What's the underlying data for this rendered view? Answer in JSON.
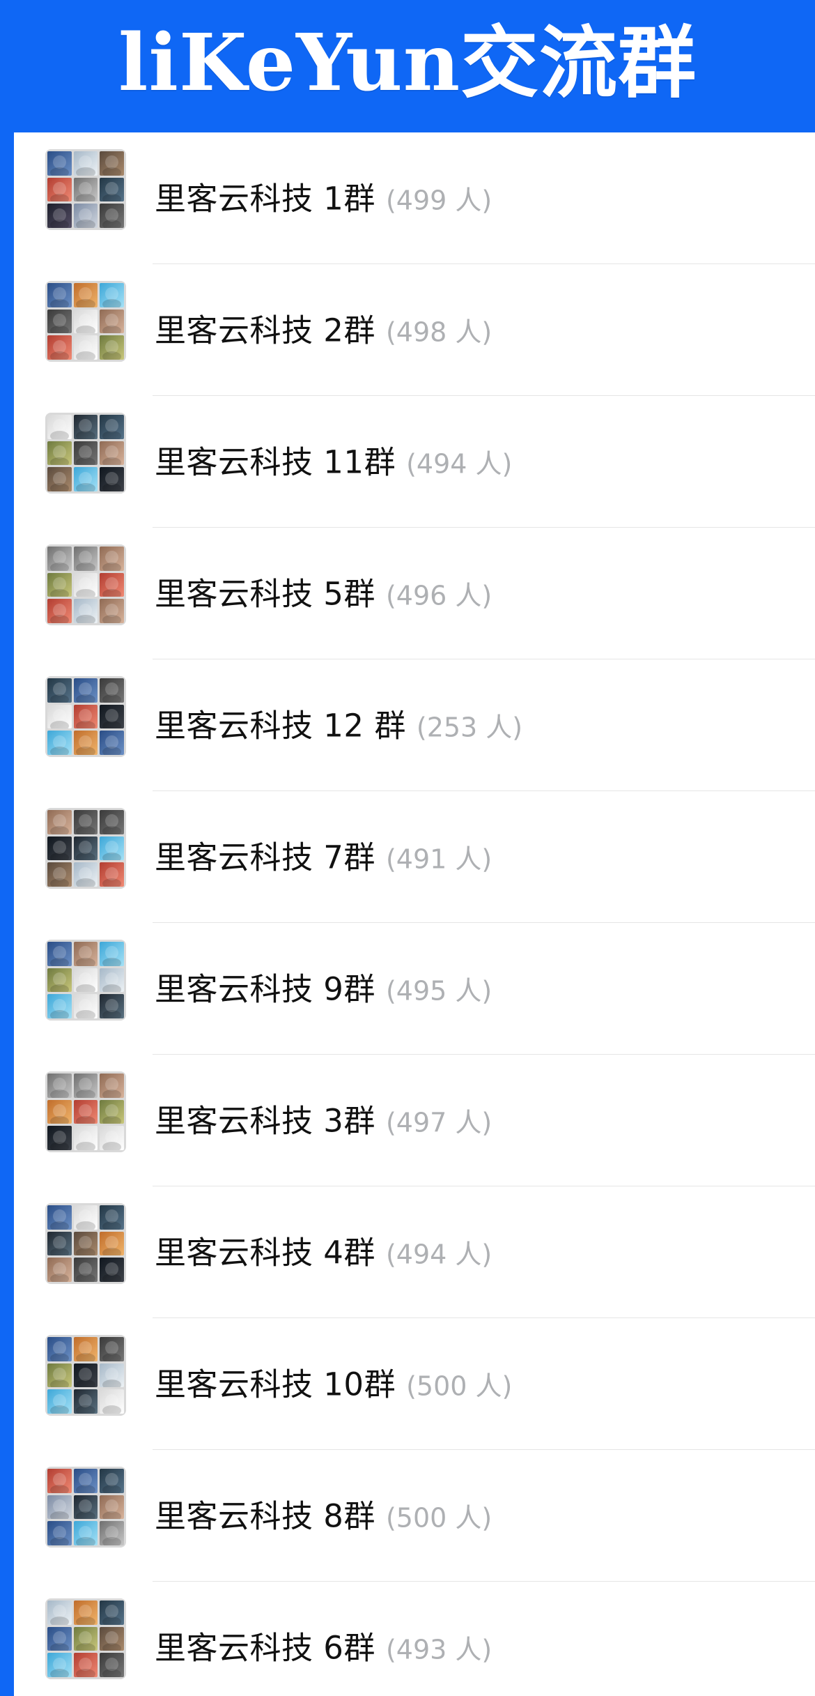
{
  "banner": {
    "title": "liKeYun交流群"
  },
  "groups": [
    {
      "name": "里客云科技 1群",
      "count": "(499 人)",
      "avatar_tiles": [
        "c0",
        "c7",
        "c2",
        "c4",
        "c3",
        "c5",
        "c8",
        "c1",
        "c6"
      ]
    },
    {
      "name": "里客云科技 2群",
      "count": "(498 人)",
      "avatar_tiles": [
        "c0",
        "c15",
        "c9",
        "c6",
        "c13",
        "c11",
        "c4",
        "c13",
        "c10"
      ]
    },
    {
      "name": "里客云科技 11群",
      "count": "(494 人)",
      "avatar_tiles": [
        "c13",
        "c12",
        "c5",
        "c10",
        "c6",
        "c11",
        "c2",
        "c9",
        "c14"
      ]
    },
    {
      "name": "里客云科技 5群",
      "count": "(496 人)",
      "avatar_tiles": [
        "c3",
        "c3",
        "c11",
        "c10",
        "c13",
        "c4",
        "c4",
        "c7",
        "c11"
      ]
    },
    {
      "name": "里客云科技 12 群",
      "count": "(253 人)",
      "avatar_tiles": [
        "c5",
        "c0",
        "c6",
        "c13",
        "c4",
        "c14",
        "c9",
        "c15",
        "c0"
      ]
    },
    {
      "name": "里客云科技 7群",
      "count": "(491 人)",
      "avatar_tiles": [
        "c11",
        "c6",
        "c6",
        "c14",
        "c12",
        "c9",
        "c2",
        "c7",
        "c4"
      ]
    },
    {
      "name": "里客云科技 9群",
      "count": "(495 人)",
      "avatar_tiles": [
        "c0",
        "c11",
        "c9",
        "c10",
        "c13",
        "c7",
        "c9",
        "c13",
        "c12"
      ]
    },
    {
      "name": "里客云科技 3群",
      "count": "(497 人)",
      "avatar_tiles": [
        "c3",
        "c3",
        "c11",
        "c15",
        "c4",
        "c10",
        "c14",
        "c13",
        "c13"
      ]
    },
    {
      "name": "里客云科技 4群",
      "count": "(494 人)",
      "avatar_tiles": [
        "c0",
        "c13",
        "c5",
        "c12",
        "c2",
        "c15",
        "c11",
        "c6",
        "c14"
      ]
    },
    {
      "name": "里客云科技 10群",
      "count": "(500 人)",
      "avatar_tiles": [
        "c0",
        "c15",
        "c6",
        "c10",
        "c14",
        "c7",
        "c9",
        "c12",
        "c13"
      ]
    },
    {
      "name": "里客云科技 8群",
      "count": "(500 人)",
      "avatar_tiles": [
        "c4",
        "c0",
        "c5",
        "c1",
        "c12",
        "c11",
        "c0",
        "c9",
        "c3"
      ]
    },
    {
      "name": "里客云科技 6群",
      "count": "(493 人)",
      "avatar_tiles": [
        "c7",
        "c15",
        "c5",
        "c0",
        "c10",
        "c2",
        "c9",
        "c4",
        "c6"
      ]
    }
  ],
  "colors": {
    "frame_blue": "#0f67f5",
    "title_white": "#ffffff",
    "name_text": "#111111",
    "count_text": "#aeb0b3",
    "divider": "#e5e5e5"
  },
  "icons": {
    "group_avatar": "group-avatar-icon"
  }
}
